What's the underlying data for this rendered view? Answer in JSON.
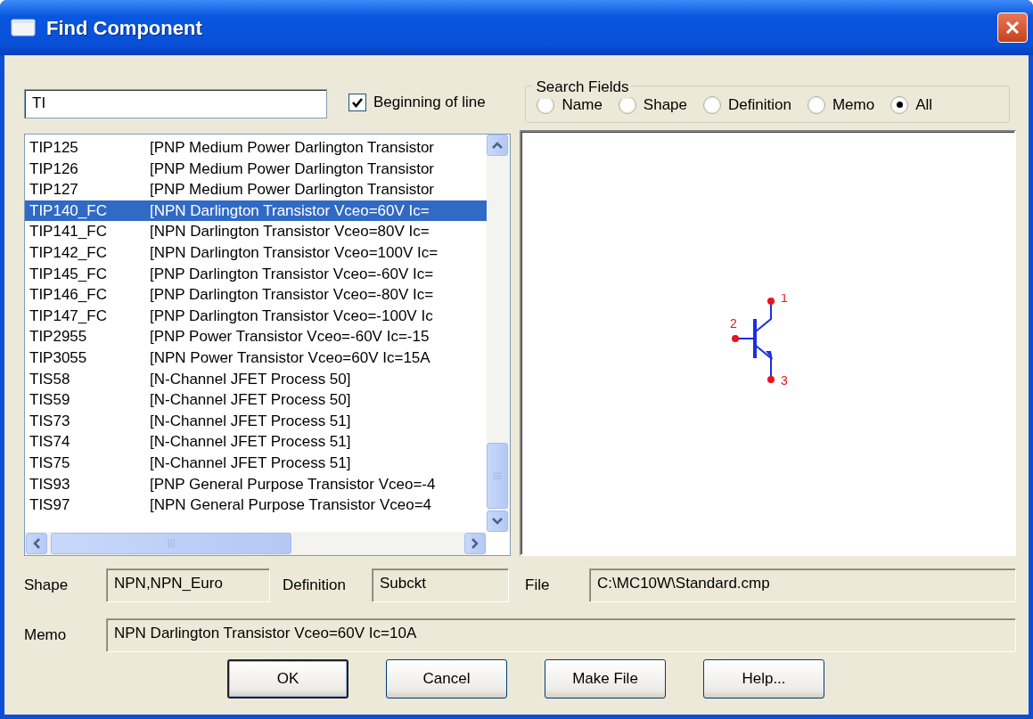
{
  "window": {
    "title": "Find Component"
  },
  "search": {
    "value": "TI"
  },
  "beginning_of_line": {
    "label": "Beginning of line",
    "checked": true
  },
  "search_fields": {
    "title": "Search Fields",
    "options": [
      {
        "label": "Name",
        "selected": false
      },
      {
        "label": "Shape",
        "selected": false
      },
      {
        "label": "Definition",
        "selected": false
      },
      {
        "label": "Memo",
        "selected": false
      },
      {
        "label": "All",
        "selected": true
      }
    ]
  },
  "components": [
    {
      "name": "TIP125",
      "description": "[PNP Medium Power Darlington Transistor",
      "selected": false
    },
    {
      "name": "TIP126",
      "description": "[PNP Medium Power Darlington Transistor",
      "selected": false
    },
    {
      "name": "TIP127",
      "description": "[PNP Medium Power Darlington Transistor",
      "selected": false
    },
    {
      "name": "TIP140_FC",
      "description": "[NPN Darlington Transistor Vceo=60V Ic=",
      "selected": true
    },
    {
      "name": "TIP141_FC",
      "description": "[NPN Darlington Transistor Vceo=80V Ic=",
      "selected": false
    },
    {
      "name": "TIP142_FC",
      "description": "[NPN Darlington Transistor Vceo=100V Ic=",
      "selected": false
    },
    {
      "name": "TIP145_FC",
      "description": "[PNP Darlington Transistor Vceo=-60V Ic=",
      "selected": false
    },
    {
      "name": "TIP146_FC",
      "description": "[PNP Darlington Transistor Vceo=-80V Ic=",
      "selected": false
    },
    {
      "name": "TIP147_FC",
      "description": "[PNP Darlington Transistor Vceo=-100V Ic",
      "selected": false
    },
    {
      "name": "TIP2955",
      "description": "[PNP Power Transistor Vceo=-60V Ic=-15",
      "selected": false
    },
    {
      "name": "TIP3055",
      "description": "[NPN Power Transistor Vceo=60V Ic=15A",
      "selected": false
    },
    {
      "name": "TIS58",
      "description": "[N-Channel JFET Process 50]",
      "selected": false
    },
    {
      "name": "TIS59",
      "description": "[N-Channel JFET Process 50]",
      "selected": false
    },
    {
      "name": "TIS73",
      "description": "[N-Channel JFET Process 51]",
      "selected": false
    },
    {
      "name": "TIS74",
      "description": "[N-Channel JFET Process 51]",
      "selected": false
    },
    {
      "name": "TIS75",
      "description": "[N-Channel JFET Process 51]",
      "selected": false
    },
    {
      "name": "TIS93",
      "description": "[PNP General Purpose Transistor Vceo=-4",
      "selected": false
    },
    {
      "name": "TIS97",
      "description": "[NPN General Purpose Transistor Vceo=4",
      "selected": false
    }
  ],
  "preview": {
    "pins": [
      "1",
      "2",
      "3"
    ]
  },
  "details": {
    "shape_label": "Shape",
    "shape": "NPN,NPN_Euro",
    "definition_label": "Definition",
    "definition": "Subckt",
    "file_label": "File",
    "file": "C:\\MC10W\\Standard.cmp",
    "memo_label": "Memo",
    "memo": "NPN Darlington Transistor Vceo=60V Ic=10A"
  },
  "buttons": [
    {
      "label": "OK",
      "default": true
    },
    {
      "label": "Cancel",
      "default": false
    },
    {
      "label": "Make File",
      "default": false
    },
    {
      "label": "Help...",
      "default": false
    }
  ]
}
